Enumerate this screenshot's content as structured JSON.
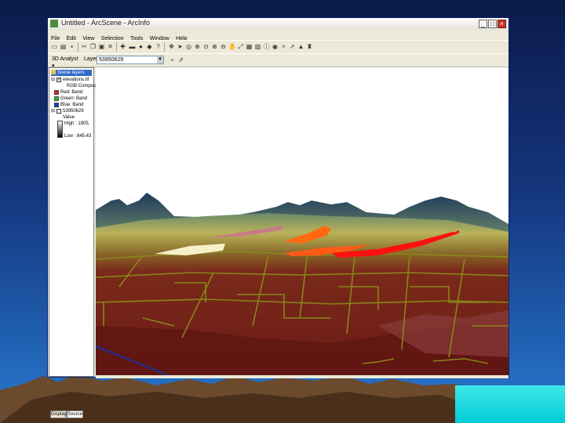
{
  "window": {
    "title": "Untitled - ArcScene - ArcInfo"
  },
  "menu": [
    "File",
    "Edit",
    "View",
    "Selection",
    "Tools",
    "Window",
    "Help"
  ],
  "toolbar2": {
    "layer_dropdown": "3D Analyst",
    "layer_label": "Layer:",
    "layer_value": "53950629"
  },
  "toc": {
    "header": "Scene layers",
    "layer1_name": "elevations.tif",
    "rgb_label": "RGB Compos",
    "red_label": "Red: Band",
    "green_label": "Green: Band",
    "blue_label": "Blue: Band",
    "layer2_name": "53950629",
    "value_label": "Value",
    "high_label": "High : 1905.",
    "low_label": "Low : 845.43",
    "tab_display": "Display",
    "tab_source": "Source",
    "colors": {
      "red": "#e02020",
      "green": "#20c020",
      "blue": "#2030e0"
    }
  }
}
